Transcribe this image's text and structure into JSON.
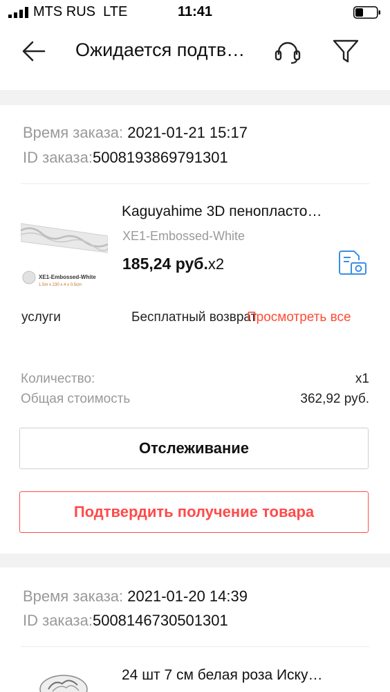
{
  "status_bar": {
    "carrier": "MTS RUS",
    "network": "LTE",
    "time": "11:41"
  },
  "header": {
    "title": "Ожидается подтв…",
    "icons": [
      "back-arrow-icon",
      "support-headset-icon",
      "filter-funnel-icon"
    ]
  },
  "orders": [
    {
      "time_label": "Время заказа:",
      "time_value": "2021-01-21 15:17",
      "id_label": "ID заказа:",
      "id_value": "5008193869791301",
      "product": {
        "name": "Kaguyahime 3D пенопласто…",
        "variant": "XE1-Embossed-White",
        "price": "185,24 руб.",
        "quantity_inline": "x2",
        "thumb_caption": "XE1-Embossed-White",
        "thumb_subcaption": "1.5m x 230 x 4 x 0.5cm"
      },
      "services": {
        "label": "услуги",
        "value": "Бесплатный возврат",
        "view_all": "Просмотреть все"
      },
      "summary": {
        "quantity_label": "Количество:",
        "quantity_value": "x1",
        "total_label": "Общая стоимость",
        "total_value": "362,92 руб."
      },
      "buttons": {
        "track": "Отслеживание",
        "confirm": "Подтвердить получение товара"
      }
    },
    {
      "time_label": "Время заказа:",
      "time_value": "2021-01-20 14:39",
      "id_label": "ID заказа:",
      "id_value": "5008146730501301",
      "product": {
        "name": "24 шт 7 см белая роза Иску…"
      }
    }
  ],
  "colors": {
    "accent": "#ff4a4a",
    "link": "#ff4a35",
    "snapshot_icon": "#3a8ee6",
    "separator": "#f2f2f2"
  }
}
